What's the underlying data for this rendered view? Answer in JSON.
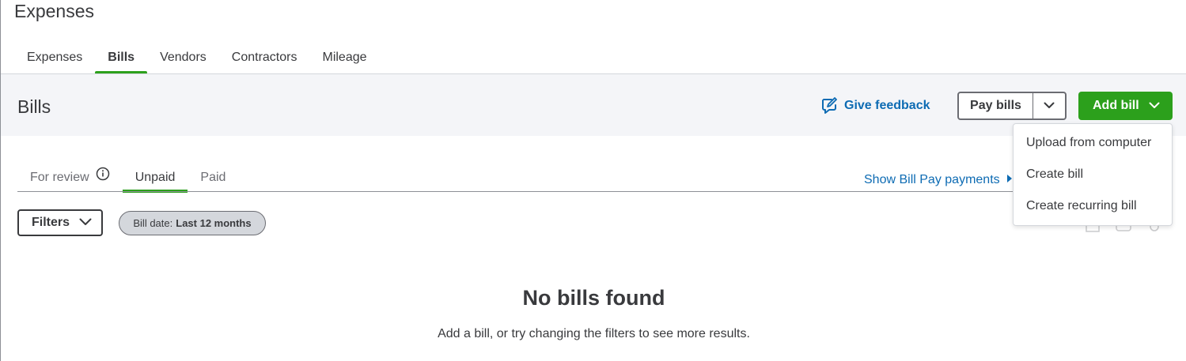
{
  "page": {
    "title": "Expenses"
  },
  "top_tabs": [
    {
      "label": "Expenses",
      "active": false
    },
    {
      "label": "Bills",
      "active": true
    },
    {
      "label": "Vendors",
      "active": false
    },
    {
      "label": "Contractors",
      "active": false
    },
    {
      "label": "Mileage",
      "active": false
    }
  ],
  "section": {
    "title": "Bills",
    "feedback_label": "Give feedback",
    "pay_bills_label": "Pay bills",
    "add_bill_label": "Add bill"
  },
  "add_bill_menu": [
    {
      "label": "Upload from computer"
    },
    {
      "label": "Create bill"
    },
    {
      "label": "Create recurring bill"
    }
  ],
  "sub_tabs": [
    {
      "label": "For review",
      "active": false
    },
    {
      "label": "Unpaid",
      "active": true
    },
    {
      "label": "Paid",
      "active": false
    }
  ],
  "show_billpay_label": "Show Bill Pay payments",
  "filters": {
    "button_label": "Filters",
    "chip_key": "Bill date:",
    "chip_value": "Last 12 months"
  },
  "empty_state": {
    "title": "No bills found",
    "subtitle": "Add a bill, or try changing the filters to see more results."
  },
  "colors": {
    "accent_green": "#2ca01c",
    "link_blue": "#0d6bb3",
    "text": "#393a3d",
    "band": "#f4f5f8"
  }
}
